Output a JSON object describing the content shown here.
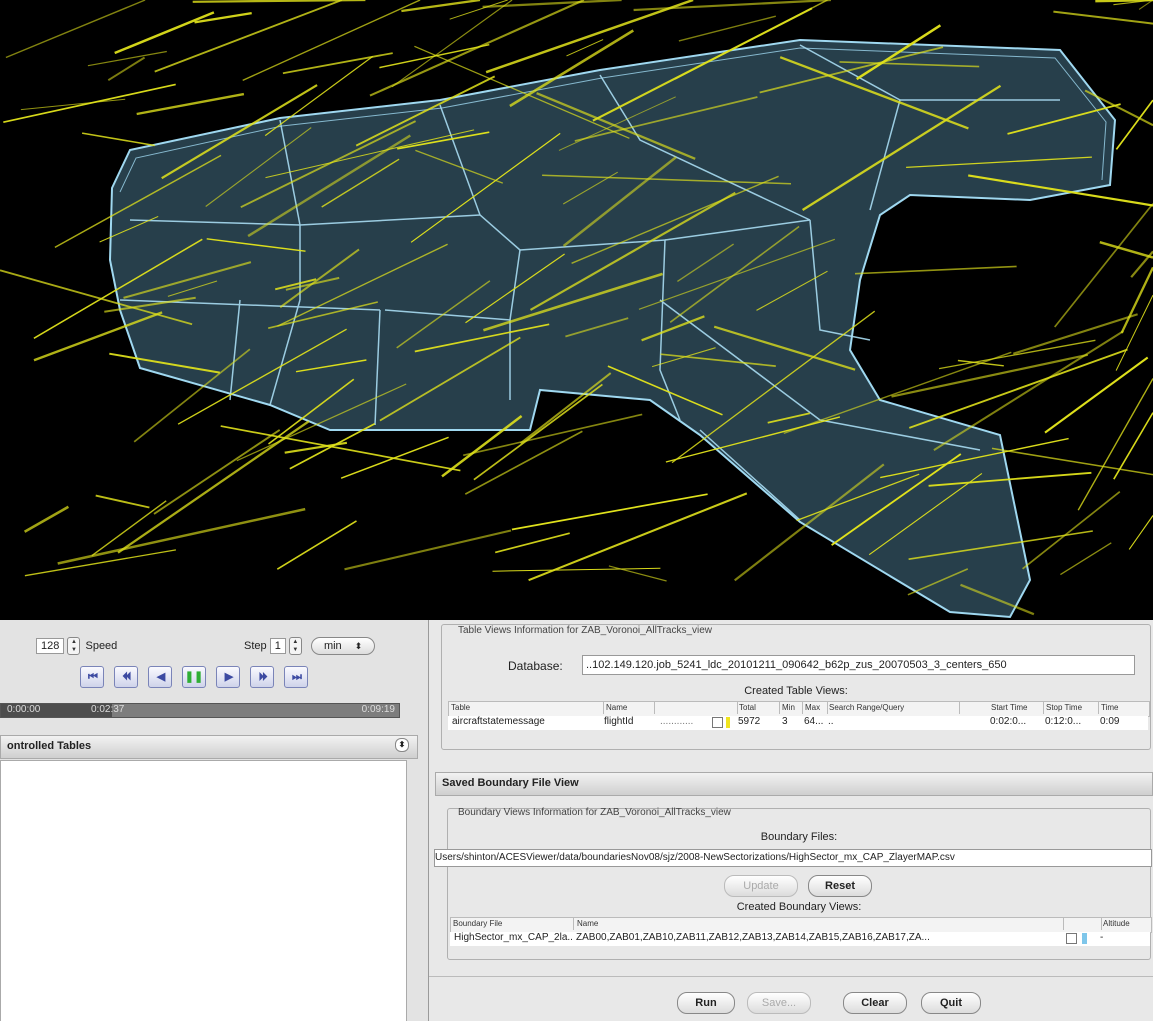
{
  "colors": {
    "sector_fill": "#2e4a58",
    "sector_stroke": "#9fd8f0",
    "track": "#e0e21c",
    "background": "#000000"
  },
  "controls": {
    "speed_value": "128",
    "speed_label": "Speed",
    "step_label": "Step",
    "step_value": "1",
    "unit_value": "min",
    "transport": {
      "first": "⏮",
      "step_back": "⏴⏴",
      "back": "◀",
      "pause": "❚❚",
      "play": "▶",
      "step_fwd": "⏵⏵",
      "last": "⏭"
    },
    "time_start": "0:00:00",
    "time_current": "0:02:37",
    "time_end": "0:09:19",
    "progress": 0.28
  },
  "controlled_tables": {
    "title": "ontrolled Tables",
    "icon": "collapse-icon"
  },
  "table_views": {
    "group_title": "Table Views Information for ZAB_Voronoi_AllTracks_view",
    "database_label": "Database:",
    "database_value": "..102.149.120.job_5241_ldc_20101211_090642_b62p_zus_20070503_3_centers_650",
    "created_label": "Created Table Views:",
    "headers": [
      "Table",
      "Name",
      "",
      "Total",
      "Min",
      "Max",
      "Search Range/Query",
      "Start Time",
      "Stop Time",
      "Time"
    ],
    "row": {
      "table": "aircraftstatemessage",
      "name": "flightId",
      "dots": "............",
      "total": "5972",
      "min": "3",
      "max": "64...",
      "query": "..",
      "start": "0:02:0...",
      "stop": "0:12:0...",
      "time": "0:09"
    }
  },
  "boundary_view": {
    "section_title": "Saved Boundary File View",
    "group_title": "Boundary Views Information for ZAB_Voronoi_AllTracks_view",
    "files_label": "Boundary Files:",
    "file_path": "Users/shinton/ACESViewer/data/boundariesNov08/sjz/2008-NewSectorizations/HighSector_mx_CAP_ZlayerMAP.csv",
    "update_label": "Update",
    "reset_label": "Reset",
    "created_label": "Created Boundary Views:",
    "headers": [
      "Boundary File",
      "Name",
      "",
      "Altitude"
    ],
    "row": {
      "file": "HighSector_mx_CAP_2la...",
      "name": "ZAB00,ZAB01,ZAB10,ZAB11,ZAB12,ZAB13,ZAB14,ZAB15,ZAB16,ZAB17,ZA...",
      "alt": "-"
    }
  },
  "bottom_buttons": {
    "run": "Run",
    "save": "Save...",
    "clear": "Clear",
    "quit": "Quit"
  }
}
